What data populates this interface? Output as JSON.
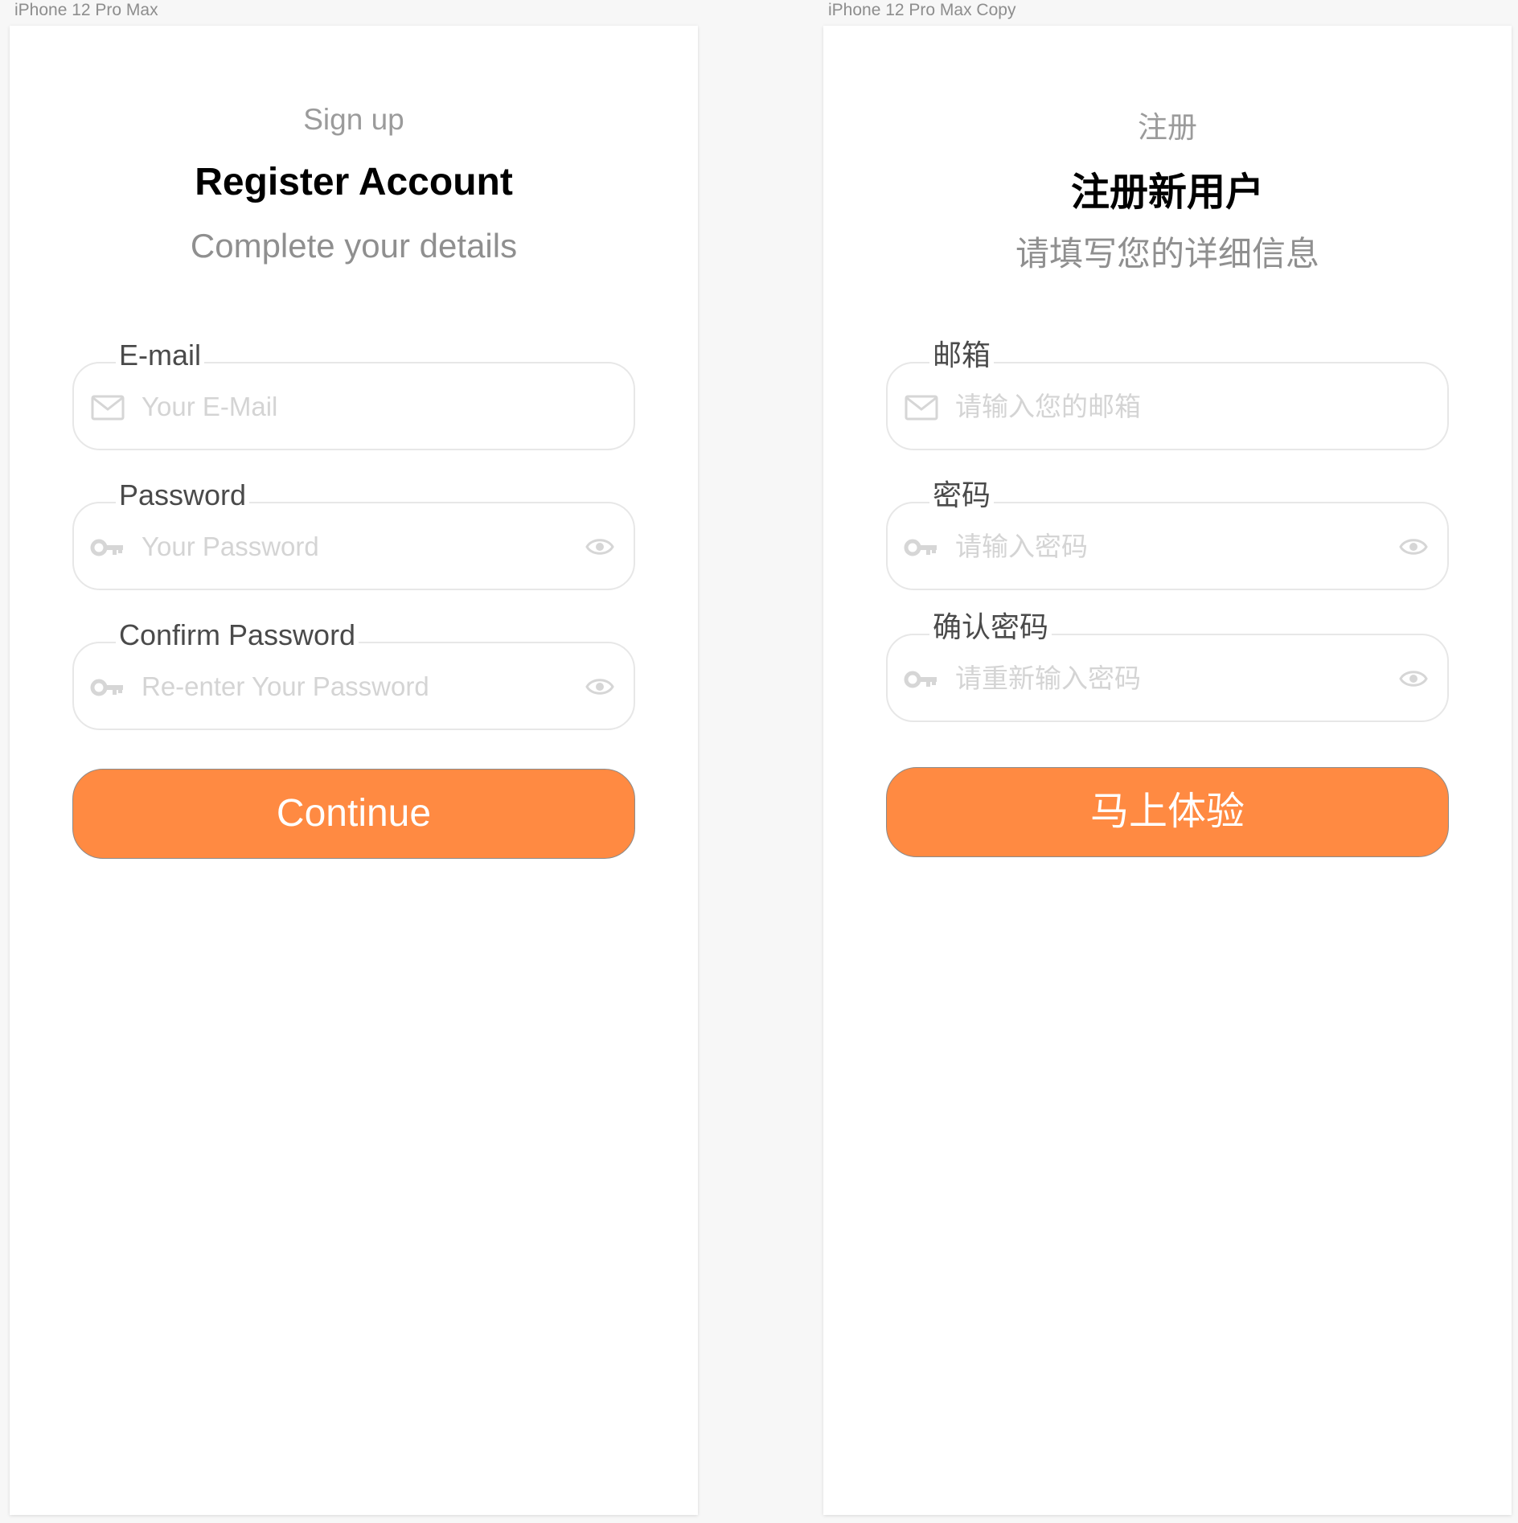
{
  "artboards": [
    {
      "frame_label": "iPhone 12 Pro Max",
      "eyebrow": "Sign up",
      "title": "Register Account",
      "subtitle": "Complete your details",
      "email": {
        "label": "E-mail",
        "placeholder": "Your E-Mail",
        "icon": "mail-icon"
      },
      "password": {
        "label": "Password",
        "placeholder": "Your Password",
        "icon": "key-icon",
        "toggle_icon": "eye-icon"
      },
      "confirm": {
        "label": "Confirm Password",
        "placeholder": "Re-enter Your Password",
        "icon": "key-icon",
        "toggle_icon": "eye-icon"
      },
      "button_label": "Continue"
    },
    {
      "frame_label": "iPhone 12 Pro Max Copy",
      "eyebrow": "注册",
      "title": "注册新用户",
      "subtitle": "请填写您的详细信息",
      "email": {
        "label": "邮箱",
        "placeholder": "请输入您的邮箱",
        "icon": "mail-icon"
      },
      "password": {
        "label": "密码",
        "placeholder": "请输入密码",
        "icon": "key-icon",
        "toggle_icon": "eye-icon"
      },
      "confirm": {
        "label": "确认密码",
        "placeholder": "请重新输入密码",
        "icon": "key-icon",
        "toggle_icon": "eye-icon"
      },
      "button_label": "马上体验"
    }
  ],
  "colors": {
    "accent": "#ff8a42",
    "field_border": "#e7e7e7",
    "placeholder": "#d4d4d4",
    "label": "#4a4a4a",
    "canvas": "#f7f7f7"
  }
}
